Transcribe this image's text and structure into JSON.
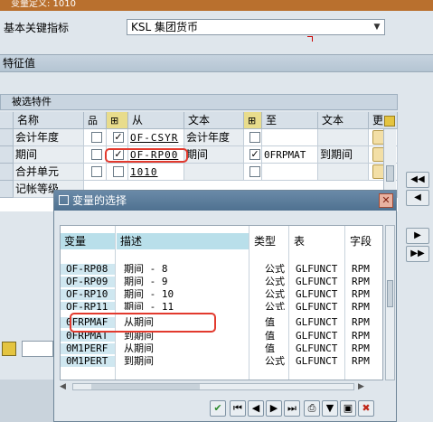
{
  "window_title": "变量定义: 1010",
  "kpi_row": {
    "label": "基本关键指标",
    "value": "KSL 集团货币"
  },
  "char_section": {
    "title": "特征值"
  },
  "selected_chars": {
    "title": "被选特件",
    "headers": {
      "name": "名称",
      "from": "从",
      "text": "文本",
      "to": "至",
      "text2": "文本",
      "more": "更"
    },
    "rows": [
      {
        "name": "会计年度",
        "from": "OF-CSYR",
        "text": "会计年度",
        "to": "",
        "text2": ""
      },
      {
        "name": "期间",
        "from": "OF-RP00",
        "text": "期间",
        "to": "0FRPMAT",
        "text2": "到期间"
      },
      {
        "name": "合并单元",
        "from": "1010",
        "text": "",
        "to": "",
        "text2": ""
      },
      {
        "name": "记帐等级",
        "from": "",
        "text": "",
        "to": "",
        "text2": ""
      }
    ]
  },
  "dialog": {
    "title": "变量的选择",
    "headers": {
      "var": "变量",
      "desc": "描述",
      "type": "类型",
      "table": "表",
      "field": "字段"
    },
    "rows": [
      {
        "var": "OF-RP08",
        "desc": "期间 - 8",
        "type": "公式",
        "table": "GLFUNCT",
        "field": "RPM"
      },
      {
        "var": "OF-RP09",
        "desc": "期间 - 9",
        "type": "公式",
        "table": "GLFUNCT",
        "field": "RPM"
      },
      {
        "var": "OF-RP10",
        "desc": "期间 - 10",
        "type": "公式",
        "table": "GLFUNCT",
        "field": "RPM"
      },
      {
        "var": "OF-RP11",
        "desc": "期间 - 11",
        "type": "公式",
        "table": "GLFUNCT",
        "field": "RPM"
      },
      {
        "var": "0FRPMAF",
        "desc": "从期间",
        "type": "值",
        "table": "GLFUNCT",
        "field": "RPM"
      },
      {
        "var": "0FRPMAT",
        "desc": "到期间",
        "type": "值",
        "table": "GLFUNCT",
        "field": "RPM"
      },
      {
        "var": "0M1PERF",
        "desc": "从期间",
        "type": "值",
        "table": "GLFUNCT",
        "field": "RPM"
      },
      {
        "var": "0M1PERT",
        "desc": "到期间",
        "type": "公式",
        "table": "GLFUNCT",
        "field": "RPM"
      }
    ]
  },
  "colors": {
    "highlight": "#e23a2e",
    "dialog_title": "#4f7190",
    "header_cyan": "#b9dfea"
  },
  "icons": [
    "dialog-icon",
    "close-icon",
    "checkmark-icon",
    "first-page-icon",
    "prev-icon",
    "next-icon",
    "last-page-icon",
    "print-icon",
    "filter-icon",
    "save-icon",
    "cancel-icon"
  ]
}
